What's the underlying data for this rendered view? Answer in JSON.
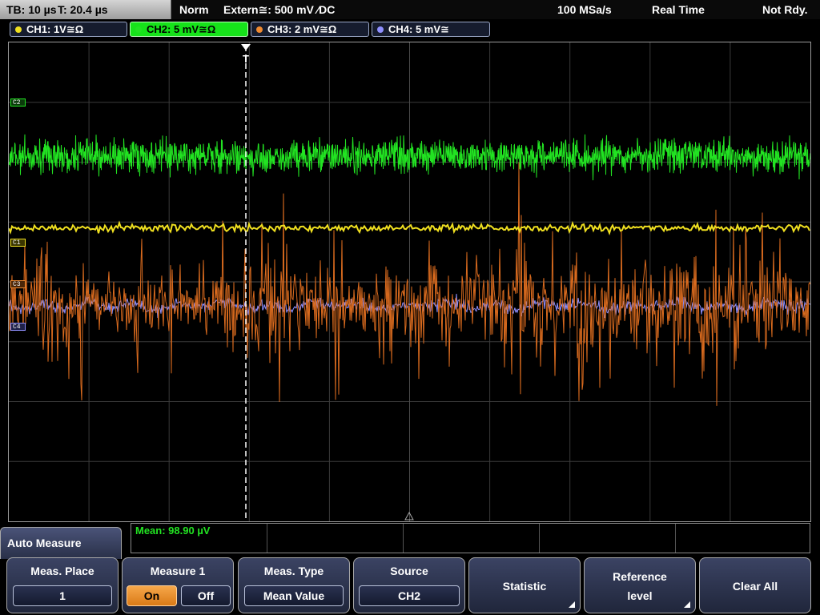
{
  "status": {
    "timebase": "TB: 10 µs",
    "trigger_time": "T: 20.4 µs",
    "mode": "Norm",
    "trigger_source": "Extern≅: 500 mV ⁄DC",
    "sample_rate": "100 MSa/s",
    "acquisition": "Real Time",
    "state": "Not Rdy."
  },
  "channels": [
    {
      "label": "CH1: 1V≅Ω",
      "color": "#f0e020",
      "active": false
    },
    {
      "label": "CH2: 5 mV≅Ω",
      "color": "#22e322",
      "active": true
    },
    {
      "label": "CH3: 2 mV≅Ω",
      "color": "#f08a30",
      "active": false
    },
    {
      "label": "CH4: 5 mV≅",
      "color": "#8f90ff",
      "active": false
    }
  ],
  "markers": [
    {
      "label": "C2",
      "color": "#22e322"
    },
    {
      "label": "C1",
      "color": "#f0e020"
    },
    {
      "label": "C3",
      "color": "#f08a30"
    },
    {
      "label": "C4",
      "color": "#8f90ff"
    }
  ],
  "trigger_marker": "T",
  "traces": {
    "ch2": {
      "color": "#22e322",
      "style": "noise band",
      "level_div": 6.1,
      "amplitude_div": 0.12
    },
    "ch1": {
      "color": "#f0e020",
      "style": "flat line",
      "level_div": 4.9,
      "amplitude_div": 0.02
    },
    "ch3": {
      "color": "#d86a1e",
      "style": "impulsive noise",
      "level_div": 3.6,
      "envelope_div": [
        1.6,
        1.4,
        2.1,
        1.0,
        1.3,
        1.8,
        1.0,
        1.2,
        1.0,
        1.6,
        1.2,
        1.0,
        1.3,
        1.1,
        1.5,
        1.1,
        1.6,
        1.0,
        1.4,
        1.8,
        2.3,
        1.8,
        1.5,
        1.1,
        1.6,
        1.3,
        1.0,
        1.0,
        1.1,
        1.4,
        1.3,
        1.6,
        1.4,
        1.0,
        1.2,
        1.0,
        1.2,
        1.6,
        2.5,
        1.4,
        1.8,
        1.0,
        2.2,
        2.0,
        1.5,
        1.4,
        1.6,
        1.9,
        1.3,
        1.4,
        2.2,
        1.8,
        2.1,
        1.0,
        1.4,
        1.3,
        1.6,
        1.2,
        1.1,
        1.3
      ]
    },
    "ch4": {
      "color": "#8f90ff",
      "style": "noisy baseline",
      "level_div": 3.6,
      "amplitude_div": 0.12
    }
  },
  "measurement": {
    "mean_text": "Mean: 98.90 µV"
  },
  "menu": {
    "title": "Auto Measure",
    "meas_place": {
      "title": "Meas. Place",
      "value": "1"
    },
    "measure1": {
      "title": "Measure 1",
      "on": "On",
      "off": "Off",
      "selected": "On"
    },
    "meas_type": {
      "title": "Meas. Type",
      "value": "Mean Value"
    },
    "source": {
      "title": "Source",
      "value": "CH2"
    },
    "statistic": "Statistic",
    "reference_level": {
      "line1": "Reference",
      "line2": "level"
    },
    "clear_all": "Clear All"
  }
}
